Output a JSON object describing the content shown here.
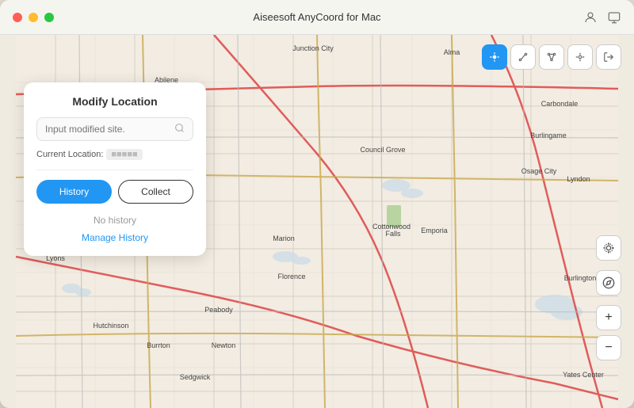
{
  "window": {
    "title": "Aiseesoft AnyCoord for Mac"
  },
  "titlebar": {
    "title": "Aiseesoft AnyCoord for Mac",
    "traffic": {
      "close": "close",
      "minimize": "minimize",
      "maximize": "maximize"
    }
  },
  "panel": {
    "title": "Modify Location",
    "search_placeholder": "Input modified site.",
    "current_location_label": "Current Location:",
    "current_location_value": "●●●●●●",
    "tab_history": "History",
    "tab_collect": "Collect",
    "no_history": "No history",
    "manage_history": "Manage History"
  },
  "map": {
    "toolbar": {
      "btn_locate": "⊙",
      "btn_route": "⊛",
      "btn_multi": "⊕",
      "btn_exit": "→"
    }
  },
  "zoom": {
    "plus": "+",
    "minus": "−"
  }
}
